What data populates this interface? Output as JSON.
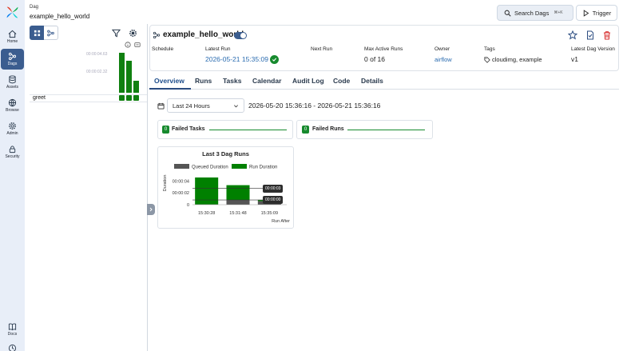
{
  "rail": {
    "items": [
      {
        "label": "Home",
        "icon": "home-icon"
      },
      {
        "label": "Dags",
        "icon": "dags-icon",
        "active": true
      },
      {
        "label": "Assets",
        "icon": "database-icon"
      },
      {
        "label": "Browse",
        "icon": "globe-icon"
      },
      {
        "label": "Admin",
        "icon": "gear-icon"
      },
      {
        "label": "Security",
        "icon": "lock-icon"
      },
      {
        "label": "Docs",
        "icon": "book-icon"
      }
    ]
  },
  "header": {
    "crumb": "Dag",
    "dag_name": "example_hello_world",
    "search_label": "Search Dags",
    "search_shortcut": "⌘+K",
    "trigger_label": "Trigger"
  },
  "grid": {
    "ticks": [
      "00:00:04.63",
      "00:00:02.32"
    ],
    "task": "greet",
    "run_durations": [
      4.63,
      3.72,
      1.42
    ],
    "color": "#108010"
  },
  "dag": {
    "title": "example_hello_world",
    "paused": false,
    "meta": {
      "schedule_label": "Schedule",
      "latest_run_label": "Latest Run",
      "latest_run": "2026-05-21 15:35:09",
      "next_run_label": "Next Run",
      "max_active_label": "Max Active Runs",
      "max_active": "0 of 16",
      "owner_label": "Owner",
      "owner": "airflow",
      "tags_label": "Tags",
      "tags": "cloudimg, example",
      "version_label": "Latest Dag Version",
      "version": "v1"
    }
  },
  "tabs": [
    "Overview",
    "Runs",
    "Tasks",
    "Calendar",
    "Audit Log",
    "Code",
    "Details"
  ],
  "range": {
    "selected": "Last 24 Hours",
    "text": "2026-05-20 15:36:16 - 2026-05-21 15:36:16"
  },
  "stats": {
    "failed_tasks_count": "0",
    "failed_tasks_label": "Failed Tasks",
    "failed_runs_count": "0",
    "failed_runs_label": "Failed Runs"
  },
  "chart_data": {
    "type": "bar",
    "stacked": true,
    "title": "Last 3 Dag Runs",
    "categories": [
      "15:30:28",
      "15:31:48",
      "15:35:09"
    ],
    "series": [
      {
        "name": "Queued Duration",
        "color": "#555555",
        "values": [
          0.05,
          0.8,
          0.6
        ]
      },
      {
        "name": "Run Duration",
        "color": "#008000",
        "values": [
          4.55,
          2.5,
          0.2
        ]
      }
    ],
    "ylabel": "Duration",
    "xlabel": "Run After",
    "yticks": [
      "00:00:04",
      "00:00:02",
      "0"
    ],
    "ytick_values": [
      4,
      2,
      0
    ],
    "ylim": [
      0,
      5
    ],
    "reference_lines": [
      {
        "label": "00:00:03",
        "value": 2.75
      },
      {
        "label": "00:00:00",
        "value": 0.8
      }
    ],
    "legend": "top"
  }
}
